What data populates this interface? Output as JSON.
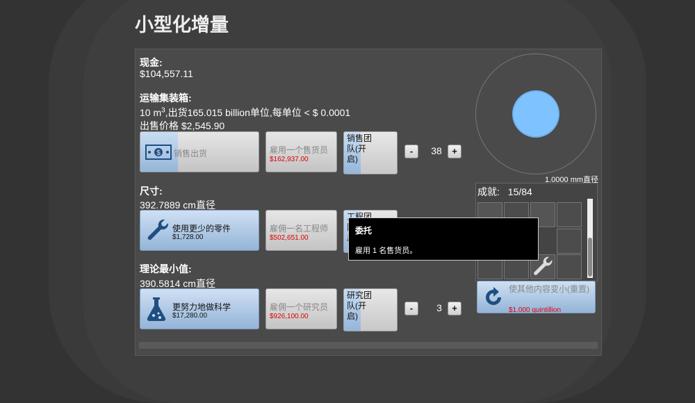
{
  "title": "小型化增量",
  "cash": {
    "label": "现金:",
    "value": "$104,557.11"
  },
  "shipping": {
    "label": "运输集装箱:",
    "volume": "10 m",
    "volume_sup": "3",
    "detail": ",出货165.015 billion单位,每单位 < $ 0.0001",
    "sale_price": "出售价格 $2,545.90",
    "main_button": {
      "label": "销售出货",
      "progress": 0.32
    },
    "hire_button": {
      "label": "雇用一个售货员",
      "price": "$162,937.00"
    },
    "team": {
      "label": "销售团队(开启)",
      "count": "38"
    }
  },
  "size": {
    "label": "尺寸:",
    "value": "392.7889 cm直径",
    "main_button": {
      "label": "使用更少的零件",
      "price": "$1,728.00"
    },
    "hire_button": {
      "label": "雇佣一名工程师",
      "price": "$502,651.00"
    },
    "team": {
      "label": "工程团队(开启)"
    }
  },
  "theoretical_min": {
    "label": "理论最小值:",
    "value": "390.5814 cm直径",
    "main_button": {
      "label": "更努力地做科学",
      "price": "$17,280.00"
    },
    "hire_button": {
      "label": "雇佣一个研究员",
      "price": "$926,100.00"
    },
    "team": {
      "label": "研究团队(开启)",
      "count": "3"
    }
  },
  "stepper": {
    "minus": "-",
    "plus": "+"
  },
  "gauge": {
    "caption": "1.0000 mm直径"
  },
  "achievements": {
    "label": "成就:",
    "progress": "15/84"
  },
  "reset": {
    "label": "使其他内容变小(重置)",
    "price": "$1.000 quintillion"
  },
  "tooltip": {
    "title": "委托",
    "body": "雇用 1 名售货员。"
  },
  "colors": {
    "background": "#333333",
    "panel": "#4a4a4a",
    "accent": "#7ec3ff",
    "price": "#dd0000"
  },
  "icons": [
    "money-icon",
    "wrench-icon",
    "flask-icon",
    "reset-icon"
  ]
}
